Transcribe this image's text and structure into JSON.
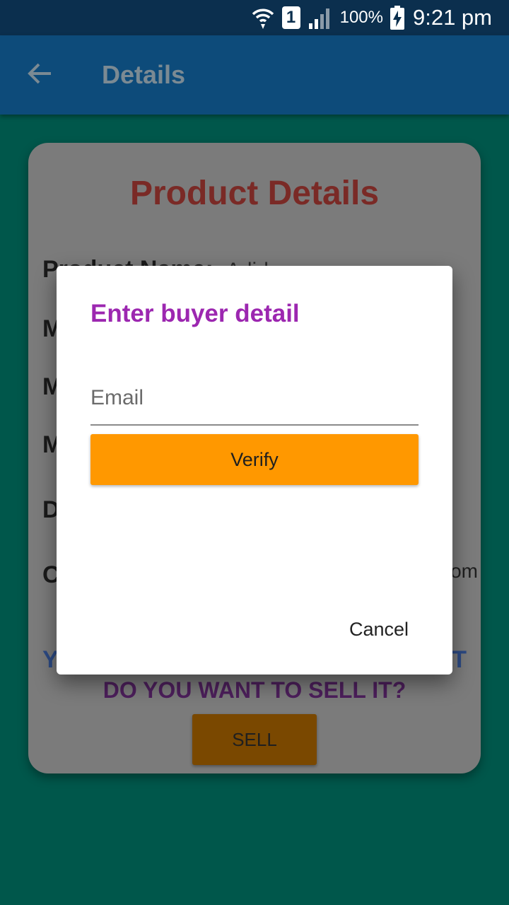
{
  "status_bar": {
    "battery_percent": "100%",
    "time": "9:21 pm",
    "sim_number": "1",
    "icons": [
      "wifi-icon",
      "sim-icon",
      "signal-icon",
      "battery-charging-icon"
    ]
  },
  "app_bar": {
    "back_icon": "arrow-back-icon",
    "title": "Details"
  },
  "card": {
    "title": "Product Details",
    "fields": [
      {
        "label": "Product Name:",
        "value": "Adid"
      },
      {
        "label": "M",
        "value": ""
      },
      {
        "label": "M",
        "value": ""
      },
      {
        "label": "M",
        "value": ""
      },
      {
        "label": "D",
        "value": ""
      },
      {
        "label": "C",
        "value": ""
      }
    ],
    "email_tail": "om",
    "owned_start": "Y",
    "owned_end": "T",
    "sell_question": "DO YOU WANT TO SELL IT?",
    "sell_button": "SELL"
  },
  "dialog": {
    "title": "Enter buyer detail",
    "email_placeholder": "Email",
    "email_value": "",
    "verify_button": "Verify",
    "cancel_button": "Cancel"
  },
  "colors": {
    "background": "#00574b",
    "app_bar": "#0d4b7a",
    "status_bar": "#0b2f4e",
    "dialog_title": "#9c27b0",
    "verify_button": "#ff9800",
    "card_title": "#c62828"
  }
}
